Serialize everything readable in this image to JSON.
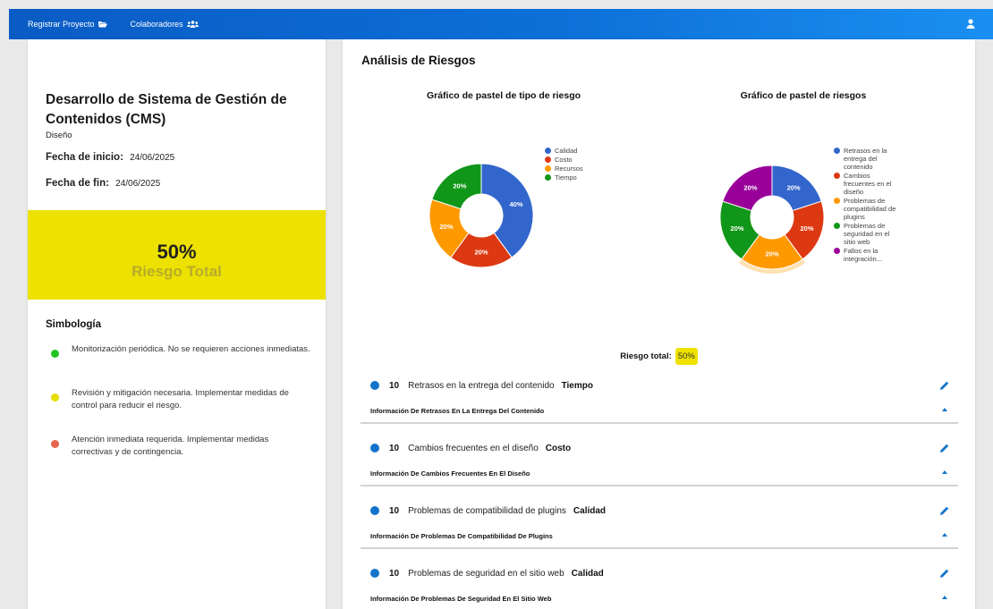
{
  "nav": {
    "items": [
      {
        "label": "Registrar Proyecto",
        "icon": "folder-open-icon"
      },
      {
        "label": "Colaboradores",
        "icon": "users-icon"
      }
    ],
    "user_icon": "user-icon"
  },
  "project": {
    "title": "Desarrollo de Sistema de Gestión de Contenidos (CMS)",
    "phase": "Diseño",
    "start_label": "Fecha de inicio:",
    "start_value": "24/06/2025",
    "end_label": "Fecha de fin:",
    "end_value": "24/06/2025",
    "risk_percent": "50%",
    "risk_label": "Riesgo Total",
    "risk_color": "#ede100"
  },
  "simbologia": {
    "title": "Simbología",
    "items": [
      {
        "color": "#22c322",
        "text": "Monitorización periódica. No se requieren acciones inmediatas."
      },
      {
        "color": "#e6dd00",
        "text": "Revisión y mitigación necesaria. Implementar medidas de control para reducir el riesgo."
      },
      {
        "color": "#e8654f",
        "text": "Atención inmediata requerida. Implementar medidas correctivas y de contingencia."
      }
    ]
  },
  "analysis": {
    "title": "Análisis de Riesgos",
    "total_label": "Riesgo total:",
    "total_value": "50%"
  },
  "chart_data": [
    {
      "type": "pie",
      "title": "Gráfico de pastel de tipo de riesgo",
      "categories": [
        "Calidad",
        "Costo",
        "Recursos",
        "Tiempo"
      ],
      "values": [
        40,
        20,
        20,
        20
      ],
      "value_labels": [
        "40%",
        "20%",
        "20%",
        "20%"
      ],
      "colors": [
        "#3366cc",
        "#dc3912",
        "#ff9900",
        "#109618"
      ],
      "legend": "right"
    },
    {
      "type": "pie",
      "title": "Gráfico de pastel de riesgos",
      "categories": [
        "Retrasos en la entrega del contenido",
        "Cambios frecuentes en el diseño",
        "Problemas de compatibilidad de plugins",
        "Problemas de seguridad en el sitio web",
        "Fallos en la integración..."
      ],
      "values": [
        20,
        20,
        20,
        20,
        20
      ],
      "value_labels": [
        "20%",
        "20%",
        "20%",
        "20%",
        "20%"
      ],
      "colors": [
        "#3366cc",
        "#dc3912",
        "#ff9900",
        "#109618",
        "#990099"
      ],
      "legend": "right"
    }
  ],
  "risks": [
    {
      "score": "10",
      "name": "Retrasos en la entrega del contenido",
      "type": "Tiempo",
      "info": "Información De Retrasos En La Entrega Del Contenido"
    },
    {
      "score": "10",
      "name": "Cambios frecuentes en el diseño",
      "type": "Costo",
      "info": "Información De Cambios Frecuentes En El Diseño"
    },
    {
      "score": "10",
      "name": "Problemas de compatibilidad de plugins",
      "type": "Calidad",
      "info": "Información De Problemas De Compatibilidad De Plugins"
    },
    {
      "score": "10",
      "name": "Problemas de seguridad en el sitio web",
      "type": "Calidad",
      "info": "Información De Problemas De Seguridad En El Sitio Web"
    }
  ]
}
